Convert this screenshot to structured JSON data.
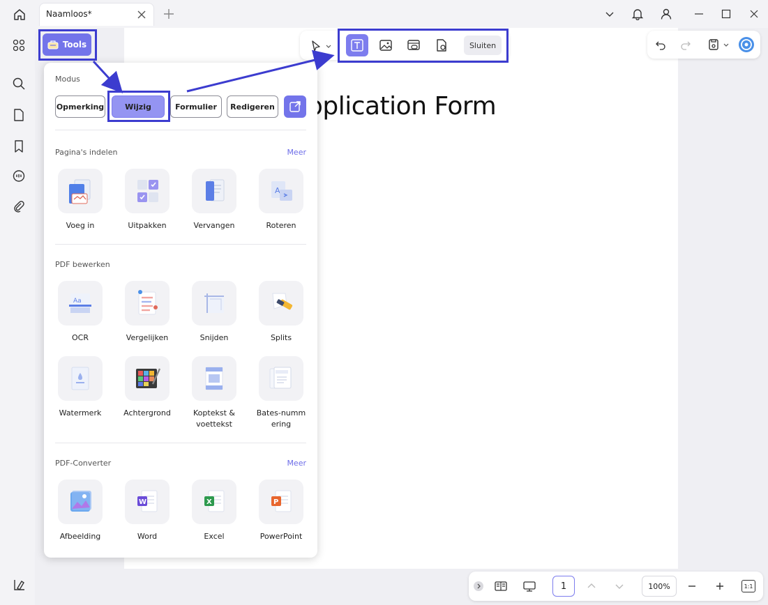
{
  "tab": {
    "title": "Naamloos*"
  },
  "document": {
    "title": "pplication Form"
  },
  "toolbar": {
    "sluiten_label": "Sluiten"
  },
  "tools_button": {
    "label": "Tools"
  },
  "panel": {
    "modus_label": "Modus",
    "modes": [
      "Opmerking",
      "Wijzig",
      "Formulier",
      "Redigeren"
    ],
    "active_mode": "Wijzig",
    "sections": [
      {
        "title": "Pagina's indelen",
        "meer": "Meer",
        "items": [
          "Voeg in",
          "Uitpakken",
          "Vervangen",
          "Roteren"
        ]
      },
      {
        "title": "PDF bewerken",
        "items": [
          "OCR",
          "Vergelijken",
          "Snijden",
          "Splits",
          "Watermerk",
          "Achtergrond",
          "Koptekst & voettekst",
          "Bates-numm ering"
        ]
      },
      {
        "title": "PDF-Converter",
        "meer": "Meer",
        "items": [
          "Afbeelding",
          "Word",
          "Excel",
          "PowerPoint"
        ]
      }
    ]
  },
  "bottombar": {
    "page_number": "1",
    "zoom": "100%",
    "fit_label": "1:1"
  },
  "colors": {
    "accent": "#7374ea",
    "annotation": "#3c3ccf",
    "mode_active": "#9494f2"
  }
}
